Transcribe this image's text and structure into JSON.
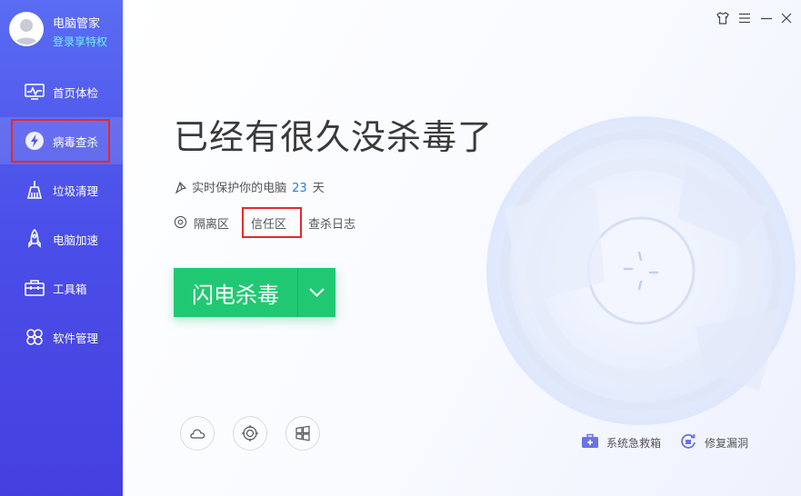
{
  "profile": {
    "app_name": "电脑管家",
    "privilege_link": "登录享特权"
  },
  "sidebar": {
    "items": [
      {
        "label": "首页体检",
        "icon": "monitor-icon"
      },
      {
        "label": "病毒查杀",
        "icon": "lightning-shield-icon",
        "active": true
      },
      {
        "label": "垃圾清理",
        "icon": "broom-icon"
      },
      {
        "label": "电脑加速",
        "icon": "rocket-icon"
      },
      {
        "label": "工具箱",
        "icon": "toolbox-icon"
      },
      {
        "label": "软件管理",
        "icon": "apps-icon"
      }
    ]
  },
  "window_controls": {
    "icons": [
      "skin-icon",
      "menu-icon",
      "minimize-icon",
      "close-icon"
    ]
  },
  "main": {
    "headline": "已经有很久没杀毒了",
    "protection_text": "实时保护你的电脑",
    "protection_days": "23",
    "protection_unit": "天",
    "links": {
      "quarantine": "隔离区",
      "trust_zone": "信任区",
      "scan_log": "查杀日志"
    },
    "scan_button": "闪电杀毒",
    "bottom_tools": [
      "cloud-icon",
      "target-icon",
      "windows-icon"
    ],
    "bottom_links": {
      "rescue_kit": "系统急救箱",
      "fix_vuln": "修复漏洞"
    }
  },
  "colors": {
    "sidebar_top": "#5a6cf3",
    "sidebar_bottom": "#463fe0",
    "accent_green": "#21c873",
    "highlight_red": "#e22a2a",
    "days_blue": "#2a7fd8"
  }
}
